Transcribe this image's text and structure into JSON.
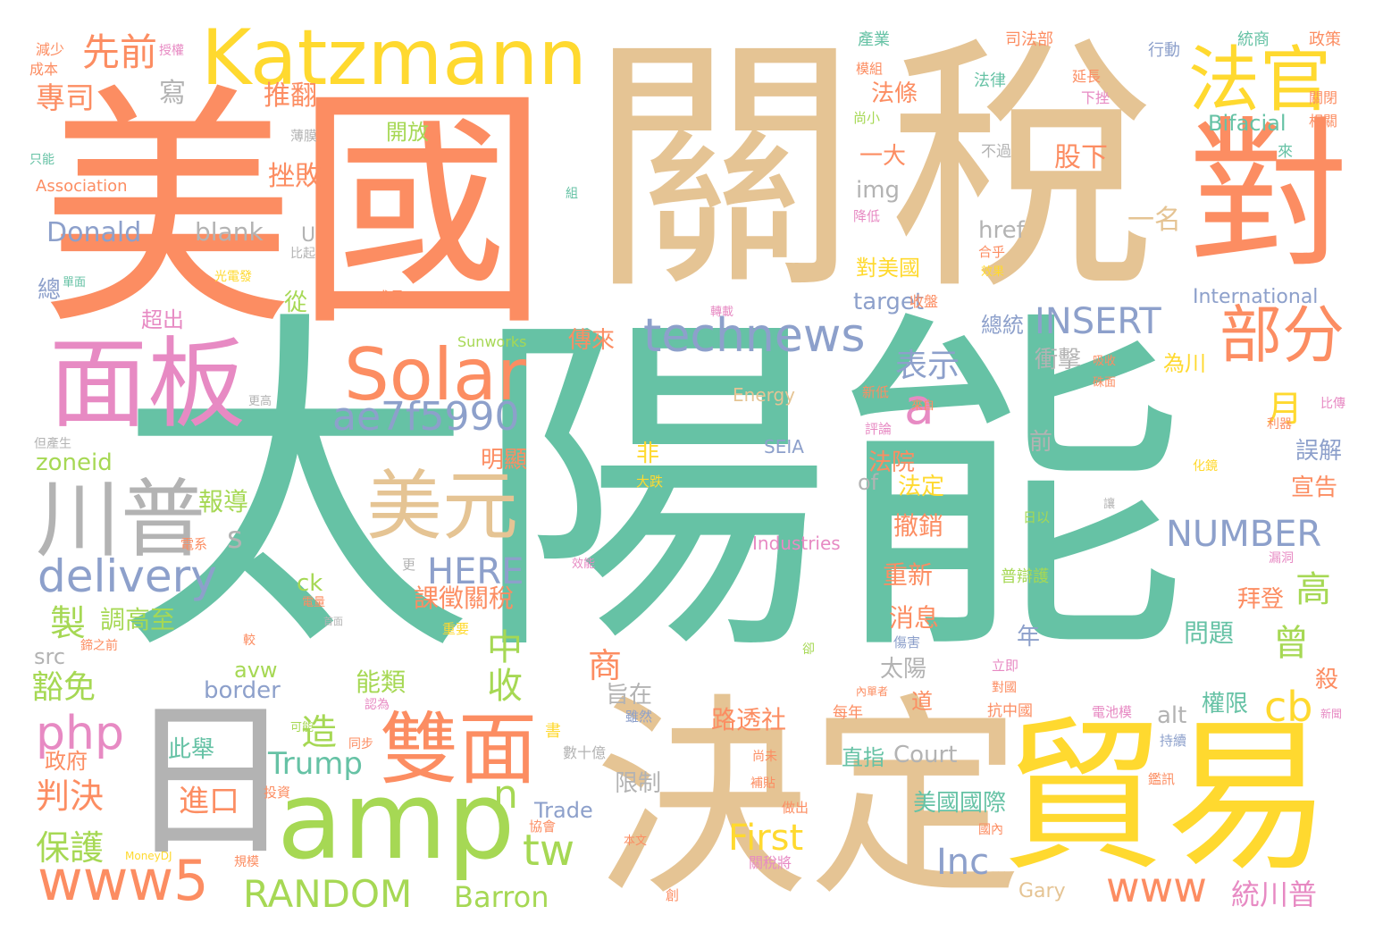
{
  "palette": {
    "teal": "#66c2a5",
    "orange": "#fc8d62",
    "blue": "#8da0cb",
    "pink": "#e78ac3",
    "green": "#a6d854",
    "yellow": "#ffd92f",
    "tan": "#e5c494",
    "gray": "#b3b3b3"
  },
  "words": [
    {
      "id": "w-taiyangneng",
      "text": "太陽能",
      "color": "teal"
    },
    {
      "id": "w-meiguo",
      "text": "美國",
      "color": "orange"
    },
    {
      "id": "w-guan",
      "text": "關",
      "color": "tan"
    },
    {
      "id": "w-shui",
      "text": "稅",
      "color": "tan"
    },
    {
      "id": "w-dui",
      "text": "對",
      "color": "orange"
    },
    {
      "id": "w-juedin",
      "text": "決定",
      "color": "tan"
    },
    {
      "id": "w-maoyi",
      "text": "貿易",
      "color": "yellow"
    },
    {
      "id": "w-ri",
      "text": "日",
      "color": "gray"
    },
    {
      "id": "w-amp",
      "text": "amp",
      "color": "green"
    },
    {
      "id": "w-mianban",
      "text": "面板",
      "color": "pink"
    },
    {
      "id": "w-katzmann",
      "text": "Katzmann",
      "color": "yellow"
    },
    {
      "id": "w-faguan",
      "text": "法官",
      "color": "yellow"
    },
    {
      "id": "w-solar",
      "text": "Solar",
      "color": "orange"
    },
    {
      "id": "w-chuanpu",
      "text": "川普",
      "color": "gray"
    },
    {
      "id": "w-meiyuan",
      "text": "美元",
      "color": "tan"
    },
    {
      "id": "w-shuangmian",
      "text": "雙面",
      "color": "orange"
    },
    {
      "id": "w-bufen",
      "text": "部分",
      "color": "orange"
    },
    {
      "id": "w-technews",
      "text": "technews",
      "color": "blue"
    },
    {
      "id": "w-ae7f5990",
      "text": "ae7f5990",
      "color": "blue"
    },
    {
      "id": "w-www5",
      "text": "www5",
      "color": "orange"
    },
    {
      "id": "w-random",
      "text": "RANDOM",
      "color": "green"
    },
    {
      "id": "w-delivery",
      "text": "delivery",
      "color": "blue"
    },
    {
      "id": "w-insert",
      "text": "INSERT",
      "color": "blue"
    },
    {
      "id": "w-number",
      "text": "NUMBER",
      "color": "blue"
    },
    {
      "id": "w-php",
      "text": "php",
      "color": "pink"
    },
    {
      "id": "w-www",
      "text": "www",
      "color": "orange"
    },
    {
      "id": "w-a",
      "text": "a",
      "color": "pink"
    },
    {
      "id": "w-xianqian",
      "text": "先前",
      "color": "orange"
    },
    {
      "id": "w-tw",
      "text": "tw",
      "color": "green"
    },
    {
      "id": "w-cb",
      "text": "cb",
      "color": "yellow"
    },
    {
      "id": "w-here",
      "text": "HERE",
      "color": "blue"
    },
    {
      "id": "w-biaoshi",
      "text": "表示",
      "color": "blue"
    },
    {
      "id": "w-first",
      "text": "First",
      "color": "yellow"
    },
    {
      "id": "w-inc",
      "text": "Inc",
      "color": "blue"
    },
    {
      "id": "w-trump",
      "text": "Trump",
      "color": "teal"
    },
    {
      "id": "w-barron",
      "text": "Barron",
      "color": "green"
    },
    {
      "id": "w-n",
      "text": "n",
      "color": "green"
    },
    {
      "id": "w-baohu",
      "text": "保護",
      "color": "green"
    },
    {
      "id": "w-panjue",
      "text": "判決",
      "color": "orange"
    },
    {
      "id": "w-jinkou",
      "text": "進口",
      "color": "orange"
    },
    {
      "id": "w-zhi",
      "text": "製",
      "color": "green"
    },
    {
      "id": "w-zao",
      "text": "造",
      "color": "green"
    },
    {
      "id": "w-zhong",
      "text": "中",
      "color": "green"
    },
    {
      "id": "w-shou",
      "text": "收",
      "color": "green"
    },
    {
      "id": "w-shang",
      "text": "商",
      "color": "orange"
    },
    {
      "id": "w-yue",
      "text": "月",
      "color": "yellow"
    },
    {
      "id": "w-gao",
      "text": "高",
      "color": "green"
    },
    {
      "id": "w-ceng",
      "text": "曾",
      "color": "green"
    },
    {
      "id": "w-tongchuanpu",
      "text": "統川普",
      "color": "pink"
    },
    {
      "id": "w-zhuansi",
      "text": "專司",
      "color": "orange"
    },
    {
      "id": "w-xie",
      "text": "寫",
      "color": "gray"
    },
    {
      "id": "w-tuifan",
      "text": "推翻",
      "color": "orange"
    },
    {
      "id": "w-cuobai",
      "text": "挫敗",
      "color": "orange"
    },
    {
      "id": "w-donald",
      "text": "Donald",
      "color": "blue"
    },
    {
      "id": "w-blank",
      "text": "blank",
      "color": "gray"
    },
    {
      "id": "w-zoneid",
      "text": "zoneid",
      "color": "green"
    },
    {
      "id": "w-baodao",
      "text": "報導",
      "color": "green"
    },
    {
      "id": "w-s",
      "text": "s",
      "color": "gray"
    },
    {
      "id": "w-diaogaozhi",
      "text": "調高至",
      "color": "green"
    },
    {
      "id": "w-kewei",
      "text": "課徵關稅",
      "color": "orange"
    },
    {
      "id": "w-huomian",
      "text": "豁免",
      "color": "green"
    },
    {
      "id": "w-src",
      "text": "src",
      "color": "gray"
    },
    {
      "id": "w-ck",
      "text": "ck",
      "color": "green"
    },
    {
      "id": "w-avw",
      "text": "avw",
      "color": "green"
    },
    {
      "id": "w-border",
      "text": "border",
      "color": "blue"
    },
    {
      "id": "w-zhengfu",
      "text": "政府",
      "color": "orange"
    },
    {
      "id": "w-cizu",
      "text": "此舉",
      "color": "teal"
    },
    {
      "id": "w-zong",
      "text": "總",
      "color": "blue"
    },
    {
      "id": "w-cong",
      "text": "從",
      "color": "green"
    },
    {
      "id": "w-chaochu",
      "text": "超出",
      "color": "pink"
    },
    {
      "id": "w-nenglei",
      "text": "能類",
      "color": "green"
    },
    {
      "id": "w-zhizai",
      "text": "旨在",
      "color": "gray"
    },
    {
      "id": "w-luyoushe",
      "text": "路透社",
      "color": "orange"
    },
    {
      "id": "w-xianzhi",
      "text": "限制",
      "color": "gray"
    },
    {
      "id": "w-trade",
      "text": "Trade",
      "color": "blue"
    },
    {
      "id": "w-chuanlai",
      "text": "傳來",
      "color": "orange"
    },
    {
      "id": "w-minxian",
      "text": "明顯",
      "color": "orange"
    },
    {
      "id": "w-fei",
      "text": "非",
      "color": "yellow"
    },
    {
      "id": "w-img",
      "text": "img",
      "color": "gray"
    },
    {
      "id": "w-href",
      "text": "href",
      "color": "gray"
    },
    {
      "id": "w-target",
      "text": "target",
      "color": "blue"
    },
    {
      "id": "w-duimeiguo",
      "text": "對美國",
      "color": "yellow"
    },
    {
      "id": "w-zongtong",
      "text": "總統",
      "color": "blue"
    },
    {
      "id": "w-chongji",
      "text": "衝擊",
      "color": "gray"
    },
    {
      "id": "w-weichuan",
      "text": "為川",
      "color": "yellow"
    },
    {
      "id": "w-fayuan",
      "text": "法院",
      "color": "orange"
    },
    {
      "id": "w-fading",
      "text": "法定",
      "color": "yellow"
    },
    {
      "id": "w-of",
      "text": "of",
      "color": "gray"
    },
    {
      "id": "w-chexiao",
      "text": "撤銷",
      "color": "orange"
    },
    {
      "id": "w-chongxin",
      "text": "重新",
      "color": "orange"
    },
    {
      "id": "w-xiaoxi",
      "text": "消息",
      "color": "orange"
    },
    {
      "id": "w-taiyang",
      "text": "太陽",
      "color": "gray"
    },
    {
      "id": "w-zhizhi",
      "text": "直指",
      "color": "teal"
    },
    {
      "id": "w-court",
      "text": "Court",
      "color": "gray"
    },
    {
      "id": "w-meiguoguoji",
      "text": "美國國際",
      "color": "teal"
    },
    {
      "id": "w-nian",
      "text": "年",
      "color": "blue"
    },
    {
      "id": "w-qian",
      "text": "前",
      "color": "gray"
    },
    {
      "id": "w-wenti",
      "text": "問題",
      "color": "teal"
    },
    {
      "id": "w-baideng",
      "text": "拜登",
      "color": "orange"
    },
    {
      "id": "w-quanxian",
      "text": "權限",
      "color": "teal"
    },
    {
      "id": "w-alt",
      "text": "alt",
      "color": "gray"
    },
    {
      "id": "w-yiming",
      "text": "一名",
      "color": "tan"
    },
    {
      "id": "w-yida",
      "text": "一大",
      "color": "orange"
    },
    {
      "id": "w-gufen",
      "text": "股下",
      "color": "orange"
    },
    {
      "id": "w-fatiao",
      "text": "法條",
      "color": "orange"
    },
    {
      "id": "w-bifacial",
      "text": "Bifacial",
      "color": "teal"
    },
    {
      "id": "w-international",
      "text": "International",
      "color": "blue"
    },
    {
      "id": "w-wujie",
      "text": "誤解",
      "color": "blue"
    },
    {
      "id": "w-xuangao",
      "text": "宣告",
      "color": "orange"
    },
    {
      "id": "w-sha",
      "text": "殺",
      "color": "orange"
    },
    {
      "id": "w-gary",
      "text": "Gary",
      "color": "tan"
    },
    {
      "id": "w-industries",
      "text": "Industries",
      "color": "pink"
    },
    {
      "id": "w-energy",
      "text": "Energy",
      "color": "tan"
    },
    {
      "id": "w-seia",
      "text": "SEIA",
      "color": "blue"
    },
    {
      "id": "w-sunworks",
      "text": "Sunworks",
      "color": "green"
    },
    {
      "id": "w-u",
      "text": "U",
      "color": "gray"
    },
    {
      "id": "w-kaifang",
      "text": "開放",
      "color": "green"
    },
    {
      "id": "w-association",
      "text": "Association",
      "color": "orange"
    },
    {
      "id": "w-chanye",
      "text": "產業",
      "color": "teal"
    },
    {
      "id": "w-sifabu",
      "text": "司法部",
      "color": "orange"
    },
    {
      "id": "w-tongshang",
      "text": "統商",
      "color": "teal"
    },
    {
      "id": "w-zhengce",
      "text": "政策",
      "color": "orange"
    },
    {
      "id": "w-xingdong",
      "text": "行動",
      "color": "blue"
    },
    {
      "id": "w-falv",
      "text": "法律",
      "color": "teal"
    },
    {
      "id": "w-yanchang",
      "text": "延長",
      "color": "orange"
    },
    {
      "id": "w-xiacuo",
      "text": "下挫",
      "color": "pink"
    },
    {
      "id": "w-guanbi",
      "text": "關閉",
      "color": "orange"
    },
    {
      "id": "w-xiangguan",
      "text": "相關",
      "color": "orange"
    },
    {
      "id": "w-mozu",
      "text": "模組",
      "color": "orange"
    },
    {
      "id": "w-shangxiao",
      "text": "尚小",
      "color": "green"
    },
    {
      "id": "w-buguo",
      "text": "不過",
      "color": "gray"
    },
    {
      "id": "w-lai",
      "text": "來",
      "color": "teal"
    },
    {
      "id": "w-jianshao",
      "text": "減少",
      "color": "orange"
    },
    {
      "id": "w-chengben",
      "text": "成本",
      "color": "orange"
    },
    {
      "id": "w-shouquan",
      "text": "授權",
      "color": "pink"
    },
    {
      "id": "w-baomo",
      "text": "薄膜",
      "color": "gray"
    },
    {
      "id": "w-zhineng",
      "text": "只能",
      "color": "teal"
    },
    {
      "id": "w-zu",
      "text": "組",
      "color": "teal"
    },
    {
      "id": "w-jiangdi",
      "text": "降低",
      "color": "pink"
    },
    {
      "id": "w-hehu",
      "text": "合乎",
      "color": "orange"
    },
    {
      "id": "w-xiaoguo",
      "text": "效果",
      "color": "yellow"
    },
    {
      "id": "w-bigi",
      "text": "比起",
      "color": "gray"
    },
    {
      "id": "w-guangdianfa",
      "text": "光電發",
      "color": "yellow"
    },
    {
      "id": "w-danmian",
      "text": "單面",
      "color": "teal"
    },
    {
      "id": "w-chengzhang",
      "text": "成長",
      "color": "orange"
    },
    {
      "id": "w-zhuanzai",
      "text": "轉載",
      "color": "pink"
    },
    {
      "id": "w-shoupan",
      "text": "收盤",
      "color": "orange"
    },
    {
      "id": "w-xindi",
      "text": "新低",
      "color": "orange"
    },
    {
      "id": "w-pinglun",
      "text": "評論",
      "color": "pink"
    },
    {
      "id": "w-xishou",
      "text": "吸收",
      "color": "orange"
    },
    {
      "id": "w-mianmian",
      "text": "硃面",
      "color": "orange"
    },
    {
      "id": "w-laizi",
      "text": "來自",
      "color": "orange"
    },
    {
      "id": "w-bizhuan",
      "text": "比傳",
      "color": "pink"
    },
    {
      "id": "w-liqi",
      "text": "利器",
      "color": "orange"
    },
    {
      "id": "w-gengao",
      "text": "更高",
      "color": "gray"
    },
    {
      "id": "w-danchansheng",
      "text": "但產生",
      "color": "gray"
    },
    {
      "id": "w-huajing",
      "text": "化鏡",
      "color": "yellow"
    },
    {
      "id": "w-dadie",
      "text": "大跌",
      "color": "yellow"
    },
    {
      "id": "w-rang",
      "text": "讓",
      "color": "gray"
    },
    {
      "id": "w-riyi",
      "text": "日以",
      "color": "green"
    },
    {
      "id": "w-dianxi",
      "text": "電系",
      "color": "orange"
    },
    {
      "id": "w-geng",
      "text": "更",
      "color": "gray"
    },
    {
      "id": "w-xiaoneng",
      "text": "效能",
      "color": "pink"
    },
    {
      "id": "w-loudong",
      "text": "漏洞",
      "color": "pink"
    },
    {
      "id": "w-dianliang",
      "text": "電量",
      "color": "orange"
    },
    {
      "id": "w-shoumian",
      "text": "首面",
      "color": "gray"
    },
    {
      "id": "w-puhuhu",
      "text": "普辯護",
      "color": "green"
    },
    {
      "id": "w-zhizhiqian",
      "text": "鍗之前",
      "color": "orange"
    },
    {
      "id": "w-zhongyao",
      "text": "重要",
      "color": "yellow"
    },
    {
      "id": "w-jiao",
      "text": "較",
      "color": "orange"
    },
    {
      "id": "w-que",
      "text": "卻",
      "color": "green"
    },
    {
      "id": "w-shanghai",
      "text": "傷害",
      "color": "blue"
    },
    {
      "id": "w-kenang",
      "text": "可能",
      "color": "green"
    },
    {
      "id": "w-renwei",
      "text": "認為",
      "color": "pink"
    },
    {
      "id": "w-tongbu",
      "text": "同步",
      "color": "orange"
    },
    {
      "id": "w-suiran",
      "text": "雖然",
      "color": "blue"
    },
    {
      "id": "w-meinian",
      "text": "每年",
      "color": "orange"
    },
    {
      "id": "w-shushiyi",
      "text": "數十億",
      "color": "gray"
    },
    {
      "id": "w-shu",
      "text": "書",
      "color": "yellow"
    },
    {
      "id": "w-shangwei",
      "text": "尚未",
      "color": "orange"
    },
    {
      "id": "w-butie",
      "text": "補貼",
      "color": "orange"
    },
    {
      "id": "w-zuochu",
      "text": "做出",
      "color": "orange"
    },
    {
      "id": "w-neidan",
      "text": "內單者",
      "color": "orange"
    },
    {
      "id": "w-dao",
      "text": "道",
      "color": "orange"
    },
    {
      "id": "w-kangzhongguo",
      "text": "抗中國",
      "color": "orange"
    },
    {
      "id": "w-liji",
      "text": "立即",
      "color": "pink"
    },
    {
      "id": "w-duiguo",
      "text": "對國",
      "color": "orange"
    },
    {
      "id": "w-dianchimo",
      "text": "電池模",
      "color": "pink"
    },
    {
      "id": "w-chixu",
      "text": "持續",
      "color": "blue"
    },
    {
      "id": "w-jianxun",
      "text": "鑑訊",
      "color": "orange"
    },
    {
      "id": "w-xinwen",
      "text": "新聞",
      "color": "pink"
    },
    {
      "id": "w-guonei",
      "text": "國內",
      "color": "orange"
    },
    {
      "id": "w-touzi",
      "text": "投資",
      "color": "orange"
    },
    {
      "id": "w-xiehui",
      "text": "協會",
      "color": "orange"
    },
    {
      "id": "w-benwen",
      "text": "本文",
      "color": "orange"
    },
    {
      "id": "w-guimo",
      "text": "規模",
      "color": "orange"
    },
    {
      "id": "w-moneydj",
      "text": "MoneyDJ",
      "color": "yellow"
    },
    {
      "id": "w-guanshuijiang",
      "text": "關稅將",
      "color": "pink"
    },
    {
      "id": "w-chuang",
      "text": "創",
      "color": "orange"
    }
  ]
}
